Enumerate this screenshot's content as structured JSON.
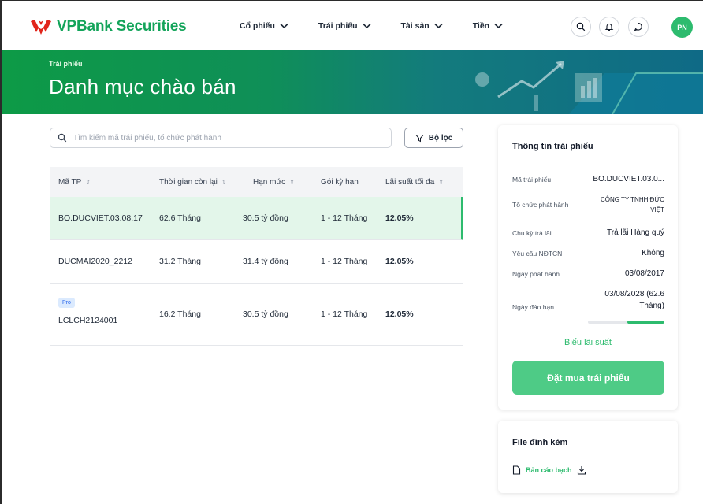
{
  "brand": {
    "name": "VPBank Securities",
    "primary": "#13a45a",
    "accent": "#2dbb6e"
  },
  "nav": [
    {
      "label": "Cổ phiếu"
    },
    {
      "label": "Trái phiếu"
    },
    {
      "label": "Tài sản"
    },
    {
      "label": "Tiền"
    }
  ],
  "header_icons": [
    "search-icon",
    "bell-icon",
    "chat-icon"
  ],
  "user": {
    "initials": "PN"
  },
  "banner": {
    "section": "Trái phiếu",
    "title": "Danh mục chào bán"
  },
  "search": {
    "placeholder": "Tìm kiếm mã trái phiếu, tổ chức phát hành"
  },
  "filter": {
    "label": "Bộ lọc"
  },
  "table": {
    "columns": [
      "Mã TP",
      "Thời gian còn lại",
      "Hạn mức",
      "Gói kỳ hạn",
      "Lãi suất tối đa"
    ],
    "rows": [
      {
        "code": "BO.DUCVIET.03.08.17",
        "remaining": "62.6 Tháng",
        "limit": "30.5 tỷ đồng",
        "term": "1 - 12 Tháng",
        "rate": "12.05%",
        "selected": true
      },
      {
        "code": "DUCMAI2020_2212",
        "remaining": "31.2 Tháng",
        "limit": "31.4 tỷ đồng",
        "term": "1 - 12 Tháng",
        "rate": "12.05%"
      },
      {
        "badge": "Pro",
        "code": "LCLCH2124001",
        "remaining": "16.2 Tháng",
        "limit": "30.5 tỷ đồng",
        "term": "1 - 12 Tháng",
        "rate": "12.05%"
      }
    ]
  },
  "info": {
    "title": "Thông tin trái phiếu",
    "fields": [
      {
        "label": "Mã trái phiếu",
        "value": "BO.DUCVIET.03.0..."
      },
      {
        "label": "Tổ chức phát hành",
        "value": "CÔNG TY TNHH ĐỨC VIỆT"
      },
      {
        "label": "Chu kỳ trả lãi",
        "value": "Trả lãi Hàng quý"
      },
      {
        "label": "Yêu cầu NĐTCN",
        "value": "Không"
      },
      {
        "label": "Ngày phát hành",
        "value": "03/08/2017"
      },
      {
        "label": "Ngày đáo hạn",
        "value": "03/08/2028 (62.6 Tháng)"
      }
    ],
    "maturity_progress": 0.48,
    "rate_chart_link": "Biểu lãi suất",
    "buy_button": "Đặt mua trái phiếu"
  },
  "attachments": {
    "title": "File đính kèm",
    "items": [
      {
        "name": "Bản cáo bạch"
      }
    ]
  }
}
